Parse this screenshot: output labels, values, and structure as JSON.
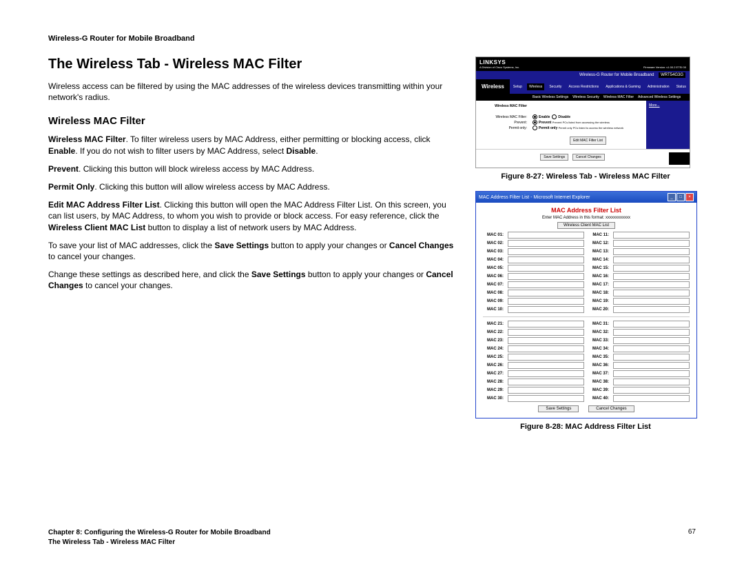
{
  "header": "Wireless-G Router for Mobile Broadband",
  "title": "The Wireless Tab - Wireless MAC Filter",
  "intro": "Wireless access can be filtered by using the MAC addresses of the wireless devices transmitting within your network's radius.",
  "subheading": "Wireless MAC Filter",
  "p_filter_b": "Wireless MAC Filter",
  "p_filter_t": ". To filter wireless users by MAC Address, either permitting or blocking access, click ",
  "p_filter_b2": "Enable",
  "p_filter_t2": ". If you do not wish to filter users by MAC Address, select ",
  "p_filter_b3": "Disable",
  "p_filter_t3": ".",
  "p_prevent_b": "Prevent",
  "p_prevent_t": ". Clicking this button will block wireless access by MAC Address.",
  "p_permit_b": "Permit Only",
  "p_permit_t": ". Clicking this button will allow wireless access by MAC Address.",
  "p_edit_b": "Edit MAC Address Filter List",
  "p_edit_t": ". Clicking this button will open the MAC Address Filter List. On this screen, you can list users, by MAC Address, to whom you wish to provide or block access. For easy reference, click the ",
  "p_edit_b2": "Wireless Client MAC List",
  "p_edit_t2": " button to display a list of network users by MAC Address.",
  "p_save_t1": "To save your list of MAC addresses, click the ",
  "p_save_b1": "Save Settings",
  "p_save_t2": " button to apply your changes or ",
  "p_save_b2": "Cancel Changes",
  "p_save_t3": " to cancel your changes.",
  "p_change_t1": "Change these settings as described here, and click the ",
  "p_change_b1": "Save Settings",
  "p_change_t2": " button to apply your changes or ",
  "p_change_b2": "Cancel Changes",
  "p_change_t3": " to cancel your changes.",
  "fig27_caption": "Figure 8-27: Wireless Tab - Wireless MAC Filter",
  "fig28_caption": "Figure 8-28: MAC Address Filter List",
  "fig27": {
    "logo": "LINKSYS",
    "logo_sub": "A Division of Cisco Systems, Inc.",
    "fw": "Firmware Version: v1.00.2 ETSI 00",
    "product": "Wireless-G Router for Mobile Broadband",
    "model": "WRT54G3G",
    "side_label": "Wireless",
    "tabs": [
      "Setup",
      "Wireless",
      "Security",
      "Access Restrictions",
      "Applications & Gaming",
      "Administration",
      "Status"
    ],
    "subtabs_left": "Wireless MAC Filter",
    "subtabs": [
      "Basic Wireless Settings",
      "Wireless Security",
      "Wireless MAC Filter",
      "Advanced Wireless Settings"
    ],
    "row1_label": "Wireless MAC Filter:",
    "row1_enable": "Enable",
    "row1_disable": "Disable",
    "row2_label": "Prevent:",
    "row2_text": "Prevent PCs listed from accessing the wireless",
    "row3_label": "Permit only:",
    "row3_text": "Permit only PCs listed to access the wireless network",
    "edit_btn": "Edit MAC Filter List",
    "save": "Save Settings",
    "cancel": "Cancel Changes",
    "more": "More..."
  },
  "fig28": {
    "win_title": "MAC Address Filter List - Microsoft Internet Explorer",
    "heading": "MAC Address Filter List",
    "sub": "Enter MAC Address in this format: xxxxxxxxxxxx",
    "top_btn": "Wireless Client MAC List",
    "left1": [
      "MAC 01:",
      "MAC 02:",
      "MAC 03:",
      "MAC 04:",
      "MAC 05:",
      "MAC 06:",
      "MAC 07:",
      "MAC 08:",
      "MAC 09:",
      "MAC 10:"
    ],
    "right1": [
      "MAC 11:",
      "MAC 12:",
      "MAC 13:",
      "MAC 14:",
      "MAC 15:",
      "MAC 16:",
      "MAC 17:",
      "MAC 18:",
      "MAC 19:",
      "MAC 20:"
    ],
    "left2": [
      "MAC 21:",
      "MAC 22:",
      "MAC 23:",
      "MAC 24:",
      "MAC 25:",
      "MAC 26:",
      "MAC 27:",
      "MAC 28:",
      "MAC 29:",
      "MAC 30:"
    ],
    "right2": [
      "MAC 31:",
      "MAC 32:",
      "MAC 33:",
      "MAC 34:",
      "MAC 35:",
      "MAC 36:",
      "MAC 37:",
      "MAC 38:",
      "MAC 39:",
      "MAC 40:"
    ],
    "save": "Save Settings",
    "cancel": "Cancel Changes"
  },
  "footer": {
    "line1": "Chapter 8: Configuring the Wireless-G Router for Mobile Broadband",
    "line2": "The Wireless Tab - Wireless MAC Filter",
    "page": "67"
  }
}
